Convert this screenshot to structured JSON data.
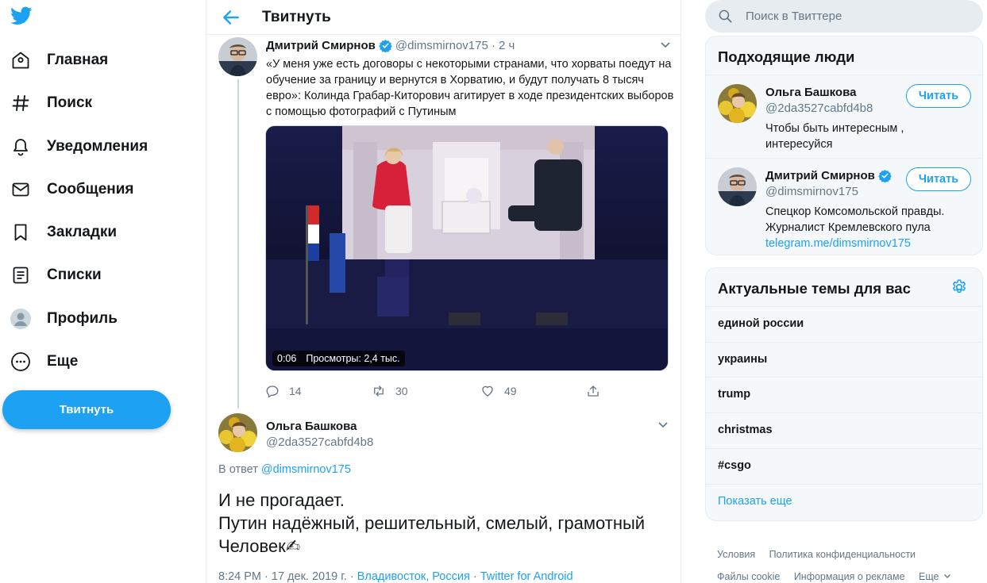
{
  "nav": {
    "items": [
      {
        "label": "Главная",
        "icon": "home-icon"
      },
      {
        "label": "Поиск",
        "icon": "hashtag-icon"
      },
      {
        "label": "Уведомления",
        "icon": "bell-icon"
      },
      {
        "label": "Сообщения",
        "icon": "mail-icon"
      },
      {
        "label": "Закладки",
        "icon": "bookmark-icon"
      },
      {
        "label": "Списки",
        "icon": "list-icon"
      },
      {
        "label": "Профиль",
        "icon": "profile-icon"
      },
      {
        "label": "Еще",
        "icon": "more-icon"
      }
    ],
    "tweet_button": "Твитнуть"
  },
  "main": {
    "title": "Твитнуть",
    "tweet1": {
      "name": "Дмитрий Смирнов",
      "handle": "@dimsmirnov175",
      "time": "· 2 ч",
      "text": "«У меня уже есть договоры с некоторыми странами, что хорваты поедут на обучение за границу и вернутся в Хорватию, и будут получать 8 тысяч евро»: Колинда Грабар-Киторович агитирует в ходе президентских выборов с помощью фотографий с Путиным",
      "video_time": "0:06",
      "video_views": "Просмотры: 2,4 тыс.",
      "replies": "14",
      "retweets": "30",
      "likes": "49"
    },
    "tweet2": {
      "name": "Ольга Башкова",
      "handle": "@2da3527cabfd4b8",
      "reply_prefix": "В ответ",
      "reply_handle": "@dimsmirnov175",
      "text_lines": [
        "И не прогадает.",
        "Путин надёжный, решительный, смелый, грамотный",
        "Человек✍"
      ],
      "time": "8:24 PM · 17 дек. 2019 г.",
      "location": "Владивосток, Россия",
      "source": "Twitter for Android"
    }
  },
  "right": {
    "search_placeholder": "Поиск в Твиттере",
    "people": {
      "title": "Подходящие люди",
      "follow_label": "Читать",
      "items": [
        {
          "name": "Ольга Башкова",
          "handle": "@2da3527cabfd4b8",
          "bio": "Чтобы быть интересным , интересуйся",
          "link": ""
        },
        {
          "name": "Дмитрий Смирнов",
          "handle": "@dimsmirnov175",
          "bio": "Спецкор Комсомольской правды. Журналист Кремлевского пула",
          "link": "telegram.me/dimsmirnov175"
        }
      ]
    },
    "trends": {
      "title": "Актуальные темы для вас",
      "items": [
        "единой россии",
        "украины",
        "trump",
        "christmas",
        "#csgo"
      ],
      "show_more": "Показать еще"
    },
    "footer": {
      "row1": [
        "Условия",
        "Политика конфиденциальности"
      ],
      "row2": [
        "Файлы cookie",
        "Информация о рекламе",
        "Еще"
      ]
    }
  },
  "colors": {
    "accent": "#1da1f2",
    "text": "#14171a",
    "secondary": "#657786"
  }
}
